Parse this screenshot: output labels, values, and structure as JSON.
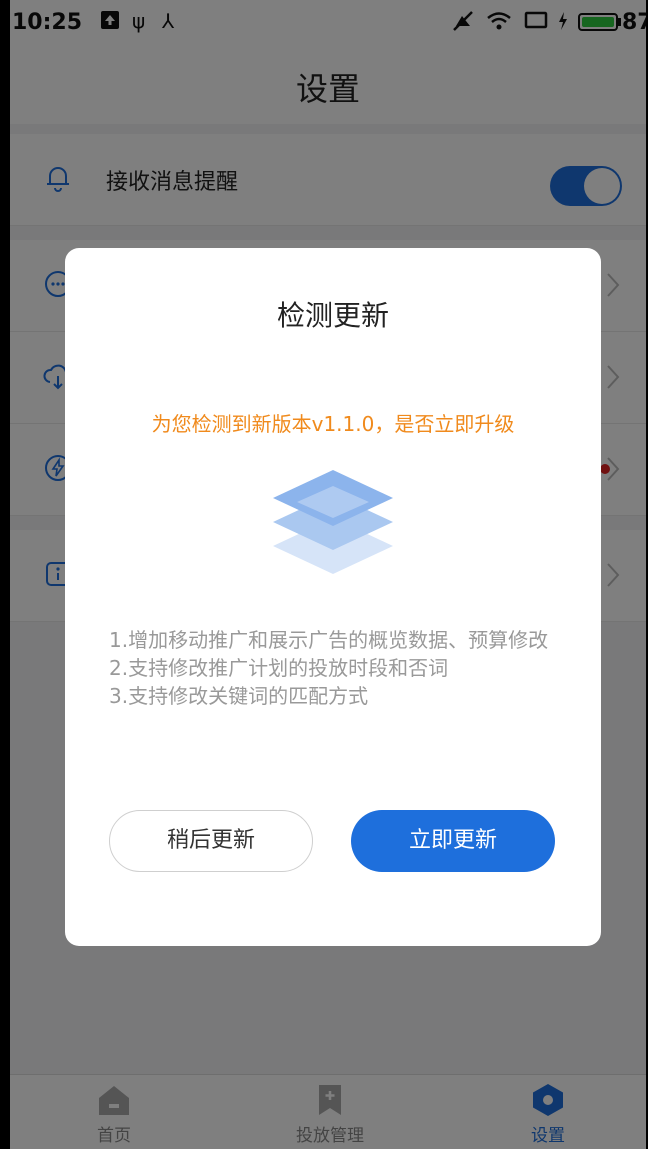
{
  "status_bar": {
    "time": "10:25",
    "battery": "87",
    "icons": [
      "upload-icon",
      "usb-icon",
      "network-icon",
      "mute-icon",
      "wifi-icon",
      "screen-icon",
      "charging-icon"
    ]
  },
  "header": {
    "title": "设置"
  },
  "settings": {
    "notifications_label": "接收消息提醒",
    "notifications_on": true
  },
  "dialog": {
    "title": "检测更新",
    "subtitle": "为您检测到新版本v1.1.0，是否立即升级",
    "notes": [
      "1.增加移动推广和展示广告的概览数据、预算修改",
      "2.支持修改推广计划的投放时段和否词",
      "3.支持修改关键词的匹配方式"
    ],
    "later_label": "稍后更新",
    "now_label": "立即更新"
  },
  "tabbar": {
    "tabs": [
      {
        "label": "首页",
        "icon": "home-icon"
      },
      {
        "label": "投放管理",
        "icon": "bookmark-icon"
      },
      {
        "label": "设置",
        "icon": "settings-icon"
      }
    ],
    "active_index": 2
  },
  "colors": {
    "accent": "#1e6fdc",
    "highlight": "#f08a1c",
    "overlay": "rgba(0,0,0,0.5)"
  }
}
